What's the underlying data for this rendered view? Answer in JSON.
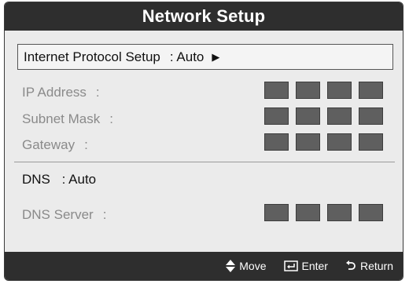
{
  "dialog": {
    "title": "Network Setup"
  },
  "protocol": {
    "label": "Internet Protocol Setup",
    "value": ": Auto"
  },
  "fields": [
    {
      "label": "IP Address",
      "colon": ":"
    },
    {
      "label": "Subnet Mask",
      "colon": ":"
    },
    {
      "label": "Gateway",
      "colon": ":"
    }
  ],
  "dns": {
    "label": "DNS",
    "value": ": Auto"
  },
  "dns_server": {
    "label": "DNS Server",
    "colon": ":"
  },
  "footer": {
    "move_label": "Move",
    "enter_label": "Enter",
    "return_label": "Return",
    "move_icon": "up-down-icon",
    "enter_icon": "enter-icon",
    "return_icon": "return-icon"
  },
  "colors": {
    "bar": "#2e2e2e",
    "panel": "#ebebeb",
    "block": "#5f5f5f",
    "disabled_text": "#8a8a8a"
  }
}
